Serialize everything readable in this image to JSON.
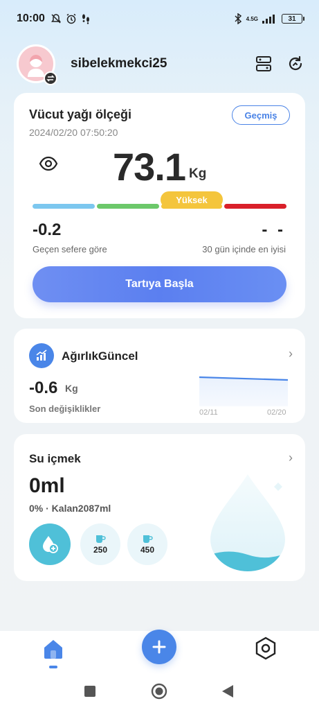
{
  "status_bar": {
    "time": "10:00",
    "network": "4.5G",
    "battery": "31"
  },
  "header": {
    "username": "sibelekmekci25"
  },
  "body_fat_card": {
    "title": "Vücut yağı ölçeği",
    "history_label": "Geçmiş",
    "timestamp": "2024/02/20 07:50:20",
    "weight": "73.1",
    "unit": "Kg",
    "level_label": "Yüksek",
    "change_value": "-0.2",
    "change_label": "Geçen sefere göre",
    "best_value": "- -",
    "best_label": "30 gün içinde en iyisi",
    "start_button": "Tartıya Başla",
    "scale_colors": [
      "#7cc7ef",
      "#6cc86a",
      "#f4c53c",
      "#d9202a"
    ]
  },
  "weight_trend_card": {
    "title": "AğırlıkGüncel",
    "value": "-0.6",
    "unit": "Kg",
    "subtitle": "Son değişiklikler",
    "chart_start_label": "02/11",
    "chart_end_label": "02/20"
  },
  "water_card": {
    "title": "Su içmek",
    "amount": "0ml",
    "remaining": "0% · Kalan2087ml",
    "cup_small": "250",
    "cup_large": "450"
  },
  "colors": {
    "accent": "#4a86e8",
    "water": "#4fc0d8"
  }
}
